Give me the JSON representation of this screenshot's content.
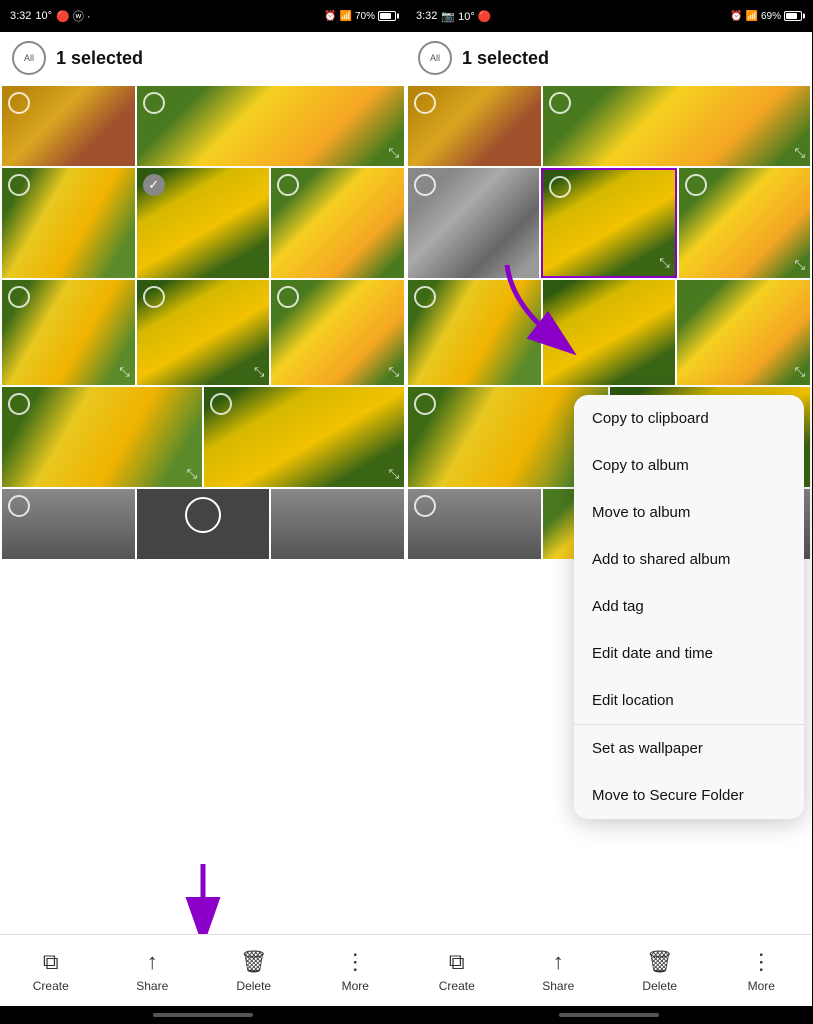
{
  "left_panel": {
    "status": {
      "time": "3:32",
      "temp": "10°",
      "battery": "70%",
      "battery_pct": 70
    },
    "header": {
      "circle_label": "All",
      "selected_text": "1 selected"
    },
    "bottom_nav": [
      {
        "icon": "⧉",
        "label": "Create"
      },
      {
        "icon": "⬆",
        "label": "Share"
      },
      {
        "icon": "🗑",
        "label": "Delete"
      },
      {
        "icon": "⋮",
        "label": "More"
      }
    ]
  },
  "right_panel": {
    "status": {
      "time": "3:32",
      "temp": "10°",
      "battery": "69%",
      "battery_pct": 69
    },
    "header": {
      "circle_label": "All",
      "selected_text": "1 selected"
    },
    "dropdown": {
      "items": [
        {
          "label": "Copy to clipboard",
          "divider": false
        },
        {
          "label": "Copy to album",
          "divider": false
        },
        {
          "label": "Move to album",
          "divider": false
        },
        {
          "label": "Add to shared album",
          "divider": false
        },
        {
          "label": "Add tag",
          "divider": false
        },
        {
          "label": "Edit date and time",
          "divider": false
        },
        {
          "label": "Edit location",
          "divider": true
        },
        {
          "label": "Set as wallpaper",
          "divider": false
        },
        {
          "label": "Move to Secure Folder",
          "divider": false
        }
      ]
    },
    "bottom_nav": [
      {
        "icon": "⧉",
        "label": "Create"
      },
      {
        "icon": "⬆",
        "label": "Share"
      },
      {
        "icon": "🗑",
        "label": "Delete"
      },
      {
        "icon": "⋮",
        "label": "More"
      }
    ]
  }
}
